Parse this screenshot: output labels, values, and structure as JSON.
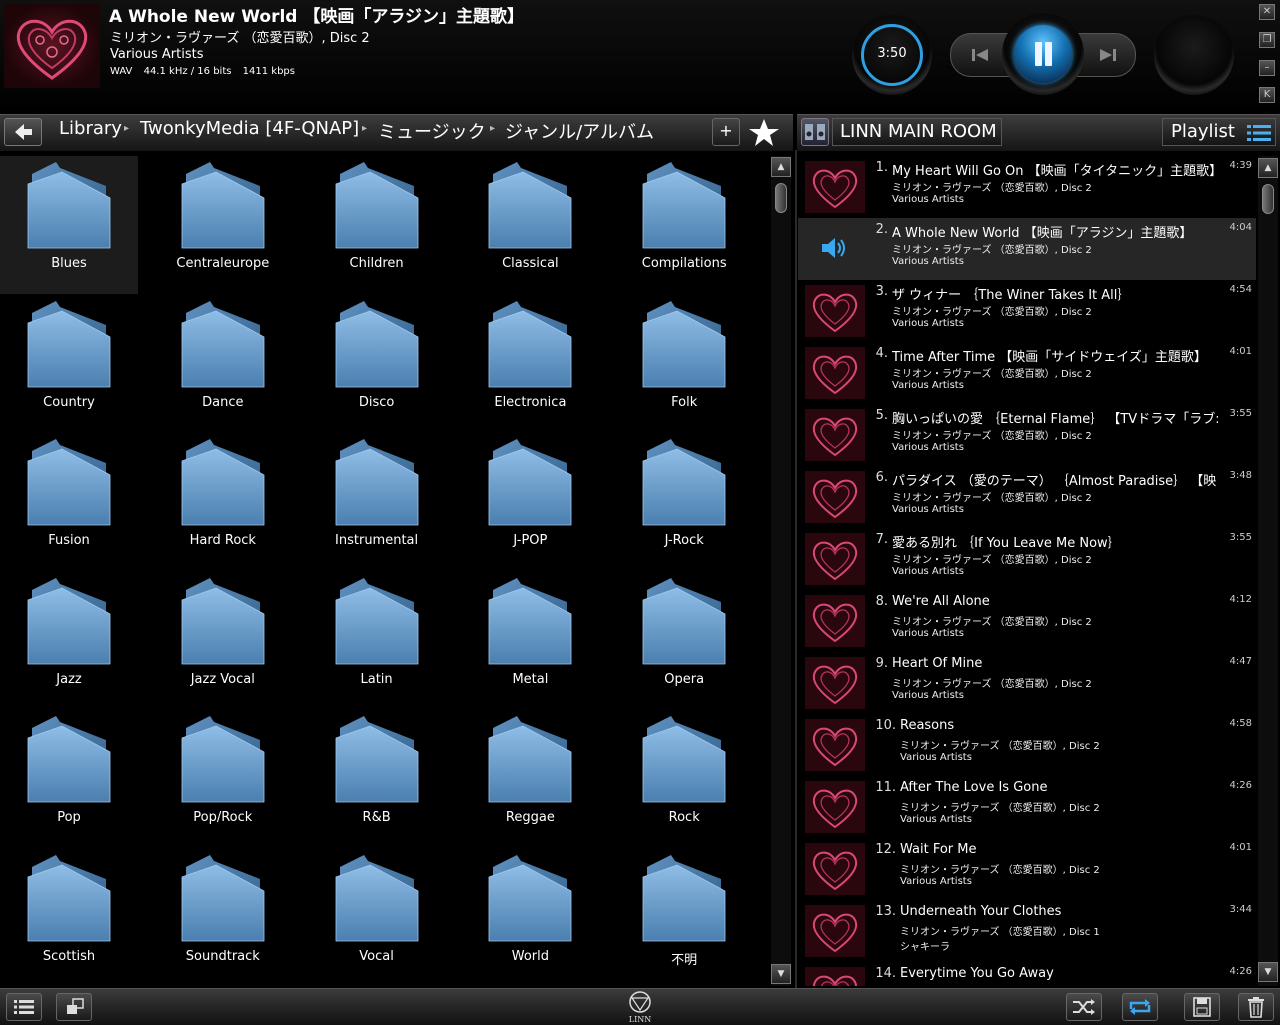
{
  "now_playing": {
    "title": "A Whole New World 【映画「アラジン」主題歌】",
    "album": "ミリオン・ラヴァーズ （恋愛百歌）, Disc 2",
    "artist": "Various Artists",
    "format": "WAV",
    "sample_rate": "44.1 kHz / 16 bits",
    "bitrate": "1411 kbps",
    "time": "3:50",
    "progress": 0.95
  },
  "breadcrumb": [
    "Library",
    "TwonkyMedia [4F-QNAP]",
    "ミュージック",
    "ジャンル/アルバム"
  ],
  "toolbar": {
    "add_label": "+"
  },
  "room": {
    "name": "LINN MAIN ROOM",
    "playlist_label": "Playlist"
  },
  "genres": [
    "Blues",
    "Centraleurope",
    "Children",
    "Classical",
    "Compilations",
    "Country",
    "Dance",
    "Disco",
    "Electronica",
    "Folk",
    "Fusion",
    "Hard Rock",
    "Instrumental",
    "J-POP",
    "J-Rock",
    "Jazz",
    "Jazz Vocal",
    "Latin",
    "Metal",
    "Opera",
    "Pop",
    "Pop/Rock",
    "R&B",
    "Reggae",
    "Rock",
    "Scottish",
    "Soundtrack",
    "Vocal",
    "World",
    "不明"
  ],
  "selected_genre": "Blues",
  "playlist": [
    {
      "num": "1.",
      "title": "My Heart Will Go On 【映画「タイタニック」主題歌】",
      "album": "ミリオン・ラヴァーズ （恋愛百歌）, Disc 2",
      "artist": "Various Artists",
      "duration": "4:39"
    },
    {
      "num": "2.",
      "title": "A Whole New World 【映画「アラジン」主題歌】",
      "album": "ミリオン・ラヴァーズ （恋愛百歌）, Disc 2",
      "artist": "Various Artists",
      "duration": "4:04",
      "current": true
    },
    {
      "num": "3.",
      "title": "ザ ウィナー ｛The Winer Takes It All｝",
      "album": "ミリオン・ラヴァーズ （恋愛百歌）, Disc 2",
      "artist": "Various Artists",
      "duration": "4:54"
    },
    {
      "num": "4.",
      "title": "Time After Time 【映画「サイドウェイズ」主題歌】",
      "album": "ミリオン・ラヴァーズ （恋愛百歌）, Disc 2",
      "artist": "Various Artists",
      "duration": "4:01"
    },
    {
      "num": "5.",
      "title": "胸いっぱいの愛 ｛Eternal Flame｝ 【TVドラマ「ラブ:",
      "album": "ミリオン・ラヴァーズ （恋愛百歌）, Disc 2",
      "artist": "Various Artists",
      "duration": "3:55"
    },
    {
      "num": "6.",
      "title": "パラダイス （愛のテーマ） ｛Almost Paradise｝ 【映",
      "album": "ミリオン・ラヴァーズ （恋愛百歌）, Disc 2",
      "artist": "Various Artists",
      "duration": "3:48"
    },
    {
      "num": "7.",
      "title": "愛ある別れ ｛If You Leave Me Now｝",
      "album": "ミリオン・ラヴァーズ （恋愛百歌）, Disc 2",
      "artist": "Various Artists",
      "duration": "3:55"
    },
    {
      "num": "8.",
      "title": "We're All Alone",
      "album": "ミリオン・ラヴァーズ （恋愛百歌）, Disc 2",
      "artist": "Various Artists",
      "duration": "4:12"
    },
    {
      "num": "9.",
      "title": "Heart Of Mine",
      "album": "ミリオン・ラヴァーズ （恋愛百歌）, Disc 2",
      "artist": "Various Artists",
      "duration": "4:47"
    },
    {
      "num": "10.",
      "title": "Reasons",
      "album": "ミリオン・ラヴァーズ （恋愛百歌）, Disc 2",
      "artist": "Various Artists",
      "duration": "4:58"
    },
    {
      "num": "11.",
      "title": "After The Love Is Gone",
      "album": "ミリオン・ラヴァーズ （恋愛百歌）, Disc 2",
      "artist": "Various Artists",
      "duration": "4:26"
    },
    {
      "num": "12.",
      "title": "Wait For Me",
      "album": "ミリオン・ラヴァーズ （恋愛百歌）, Disc 2",
      "artist": "Various Artists",
      "duration": "4:01"
    },
    {
      "num": "13.",
      "title": "Underneath Your Clothes",
      "album": "ミリオン・ラヴァーズ （恋愛百歌）, Disc 1",
      "artist": "シャキーラ",
      "duration": "3:44"
    },
    {
      "num": "14.",
      "title": "Everytime You Go Away",
      "album": "",
      "artist": "",
      "duration": "4:26"
    }
  ],
  "footer": {
    "logo_text": "LINN"
  },
  "colors": {
    "accent": "#2e9fe0",
    "folder": "#6a9ccb",
    "background": "#000000"
  }
}
